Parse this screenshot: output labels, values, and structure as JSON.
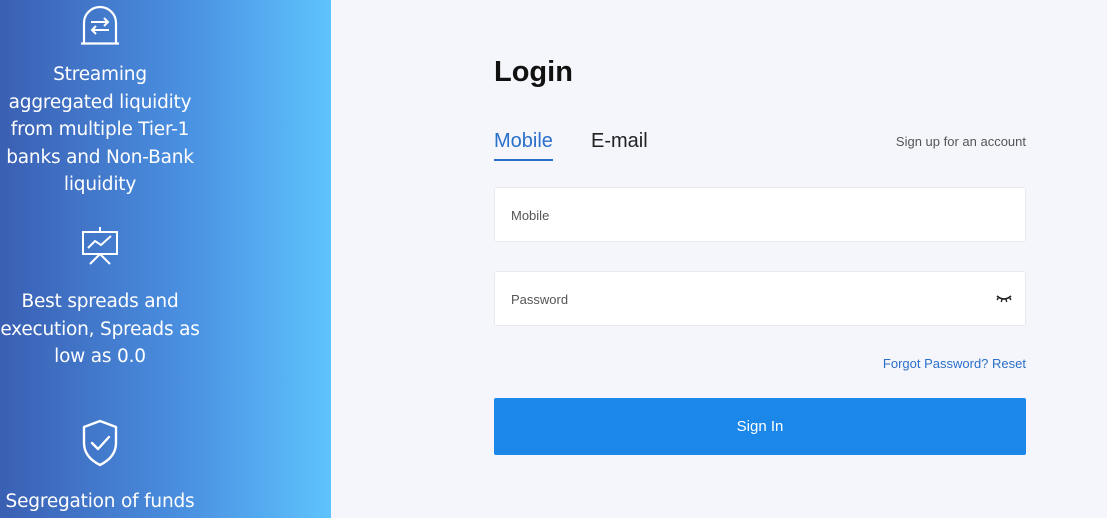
{
  "features": [
    {
      "icon": "exchange-icon",
      "text": "Streaming aggregated liquidity from multiple Tier-1 banks and Non-Bank liquidity"
    },
    {
      "icon": "chart-board-icon",
      "text": "Best spreads and execution, Spreads as low as 0.0"
    },
    {
      "icon": "shield-check-icon",
      "text": "Segregation of funds"
    }
  ],
  "login": {
    "title": "Login",
    "tabs": [
      {
        "label": "Mobile",
        "active": true
      },
      {
        "label": "E-mail",
        "active": false
      }
    ],
    "signup_link": "Sign up for an account",
    "mobile_placeholder": "Mobile",
    "password_placeholder": "Password",
    "forgot_link": "Forgot Password? Reset",
    "signin_label": "Sign In"
  },
  "colors": {
    "accent": "#1a87e9",
    "link": "#2a6fc9",
    "panel_gradient_start": "#3a5fb3",
    "panel_gradient_end": "#5ec3fd"
  }
}
